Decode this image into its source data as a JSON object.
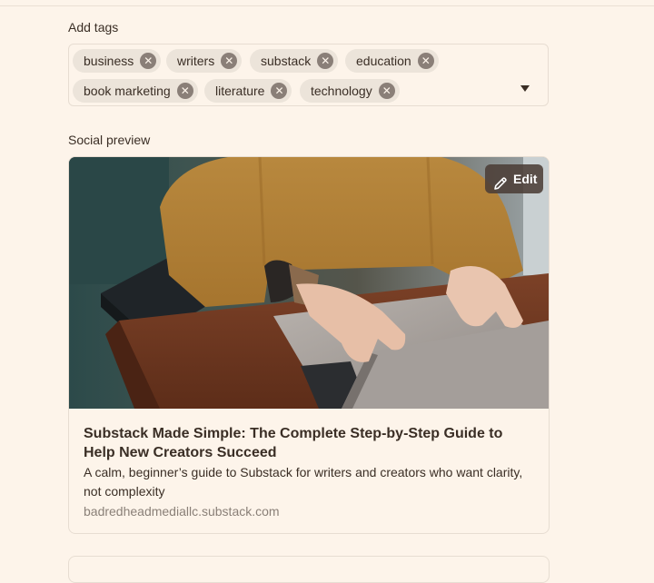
{
  "tags": {
    "label": "Add tags",
    "items": [
      "business",
      "writers",
      "substack",
      "education",
      "book marketing",
      "literature",
      "technology"
    ]
  },
  "social_preview": {
    "label": "Social preview",
    "edit_label": "Edit",
    "title": "Substack Made Simple: The Complete Step-by-Step Guide to Help New Creators Succeed",
    "description": "A calm, beginner’s guide to Substack for writers and creators who want clarity, not complexity",
    "domain": "badredheadmediallc.substack.com"
  },
  "icons": {
    "remove_tag": "close-circle-icon",
    "dropdown": "caret-down-icon",
    "edit": "pencil-icon"
  },
  "colors": {
    "background": "#fdf4ea",
    "chip": "#ece4da",
    "chip_remove": "#8a7f78",
    "edit_button": "#4b3e37"
  }
}
